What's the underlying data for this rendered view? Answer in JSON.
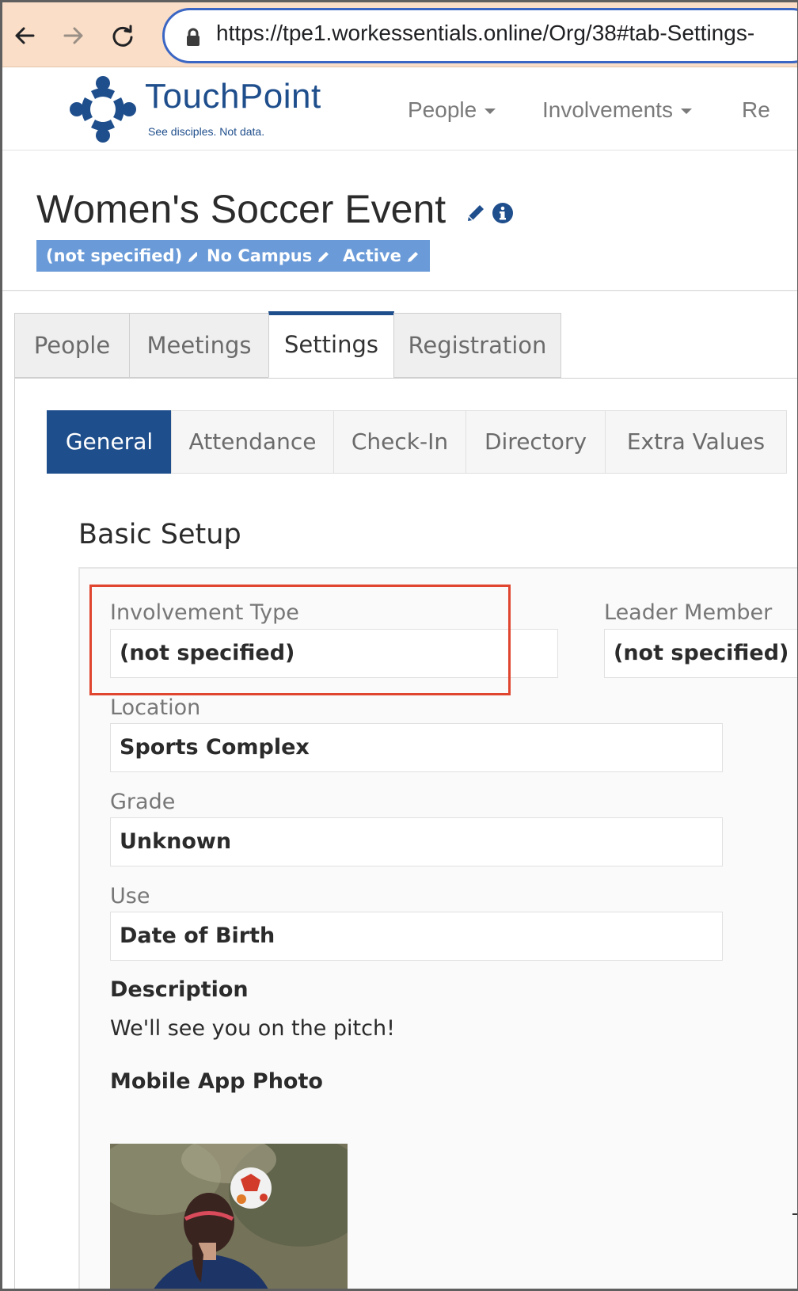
{
  "browser": {
    "url": "https://tpe1.workessentials.online/Org/38#tab-Settings-"
  },
  "site": {
    "brand_name": "TouchPoint",
    "tagline": "See disciples. Not data.",
    "nav": [
      "People",
      "Involvements",
      "Re"
    ]
  },
  "page": {
    "title": "Women's Soccer Event",
    "badges": [
      "(not specified)",
      "No Campus",
      "Active"
    ]
  },
  "main_tabs": [
    "People",
    "Meetings",
    "Settings",
    "Registration"
  ],
  "main_tab_active": "Settings",
  "sub_tabs": [
    "General",
    "Attendance",
    "Check-In",
    "Directory",
    "Extra Values"
  ],
  "sub_tab_active": "General",
  "basic_setup": {
    "title": "Basic Setup",
    "fields": [
      {
        "label": "Involvement Type",
        "value": "(not specified)"
      },
      {
        "label": "Leader Member ",
        "value": "(not specified)"
      },
      {
        "label": "Location",
        "value": "Sports Complex"
      },
      {
        "label": "Grade",
        "value": "Unknown"
      },
      {
        "label": "Use",
        "value": "Date of Birth"
      }
    ],
    "description_heading": "Description",
    "description_text": "We'll see you on the pitch!",
    "photo_heading": "Mobile App Photo"
  },
  "colors": {
    "brand": "#1f4e8c",
    "badge": "#6a9bd8",
    "highlight": "#e0452f",
    "browser_bar": "#fadec7"
  }
}
